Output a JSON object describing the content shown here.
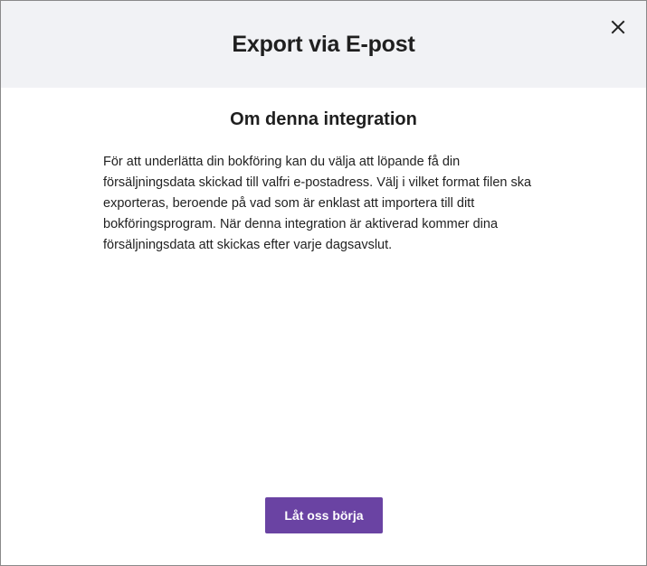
{
  "modal": {
    "title": "Export via E-post",
    "close_icon": "close-icon"
  },
  "body": {
    "section_title": "Om denna integration",
    "description": "För att underlätta din bokföring kan du välja att löpande få din försäljningsdata skickad till valfri e-postadress. Välj i vilket format filen ska exporteras, beroende på vad som är enklast att importera till ditt bokföringsprogram. När denna integration är aktiverad kommer dina försäljningsdata att skickas efter varje dagsavslut."
  },
  "footer": {
    "start_label": "Låt oss börja"
  },
  "colors": {
    "header_bg": "#f1f2f5",
    "accent": "#6a43a3"
  }
}
